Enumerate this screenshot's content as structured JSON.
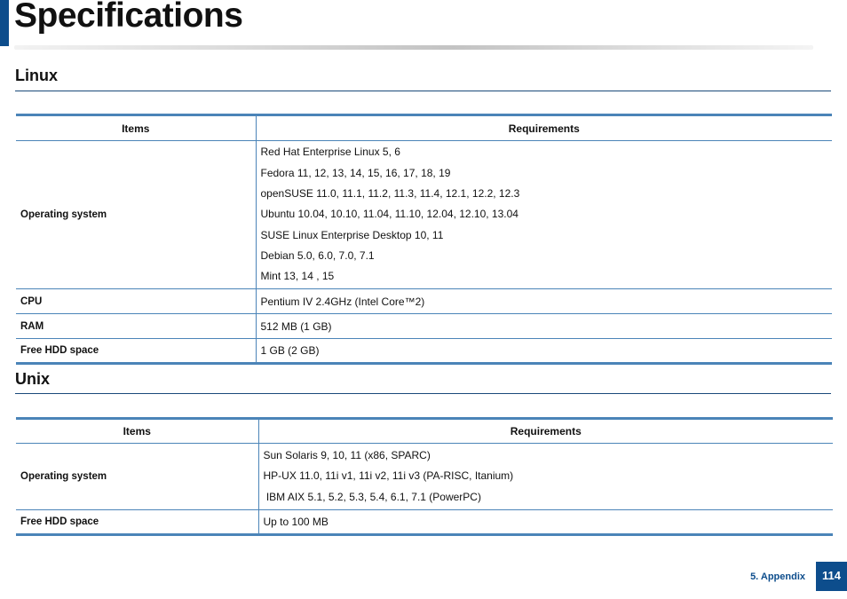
{
  "page": {
    "title": "Specifications"
  },
  "linux": {
    "heading": "Linux",
    "headers": {
      "items": "Items",
      "requirements": "Requirements"
    },
    "os": {
      "label": "Operating system",
      "lines": [
        "Red Hat Enterprise Linux 5, 6",
        "Fedora 11, 12, 13, 14, 15, 16, 17, 18, 19",
        "openSUSE 11.0, 11.1, 11.2, 11.3, 11.4, 12.1, 12.2, 12.3",
        "Ubuntu 10.04, 10.10, 11.04, 11.10, 12.04, 12.10, 13.04",
        "SUSE Linux Enterprise Desktop 10, 11",
        "Debian 5.0, 6.0, 7.0, 7.1",
        "Mint 13, 14 , 15"
      ]
    },
    "cpu": {
      "label": "CPU",
      "value": "Pentium IV 2.4GHz (Intel Core™2)"
    },
    "ram": {
      "label": "RAM",
      "value": "512 MB (1 GB)"
    },
    "hdd": {
      "label": "Free HDD space",
      "value": "1 GB (2 GB)"
    }
  },
  "unix": {
    "heading": "Unix",
    "headers": {
      "items": "Items",
      "requirements": "Requirements"
    },
    "os": {
      "label": "Operating system",
      "lines": [
        "Sun Solaris 9, 10, 11 (x86, SPARC)",
        "HP-UX 11.0, 11i v1, 11i v2, 11i v3 (PA-RISC, Itanium)",
        " IBM AIX 5.1, 5.2, 5.3, 5.4, 6.1, 7.1 (PowerPC)"
      ]
    },
    "hdd": {
      "label": "Free HDD space",
      "value": "Up to 100 MB"
    }
  },
  "footer": {
    "section": "5. Appendix",
    "page_number": "114"
  }
}
